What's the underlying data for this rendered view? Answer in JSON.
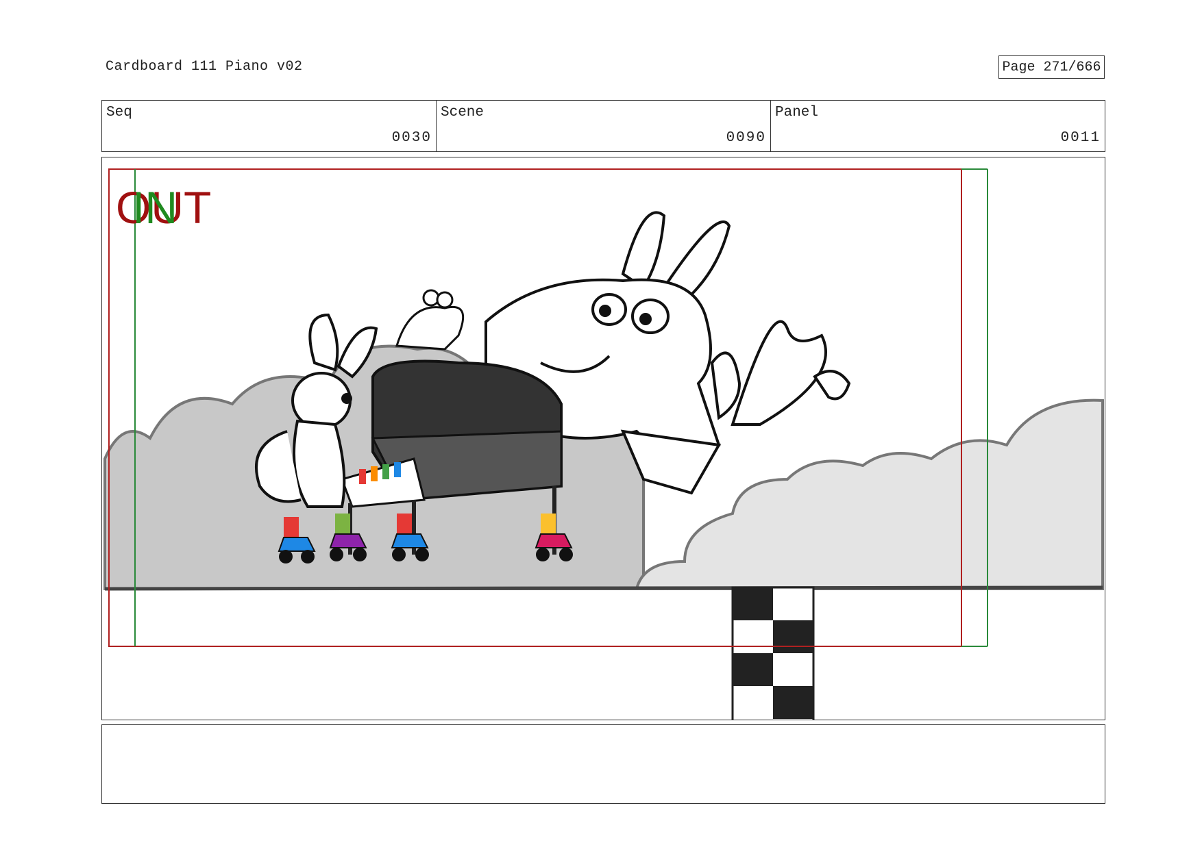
{
  "header": {
    "document_title": "Cardboard 111 Piano v02",
    "page_label": "Page 271/666"
  },
  "info": {
    "seq_label": "Seq",
    "seq_value": "0030",
    "scene_label": "Scene",
    "scene_value": "0090",
    "panel_label": "Panel",
    "panel_value": "0011"
  },
  "frame": {
    "out_marker": "OUT",
    "in_marker": "IN",
    "out_color": "#a01010",
    "in_color": "#1f8a1f",
    "safe_frame_color": "#b02020",
    "action_frame_color": "#2a8a3a"
  },
  "notes": {
    "text": ""
  }
}
